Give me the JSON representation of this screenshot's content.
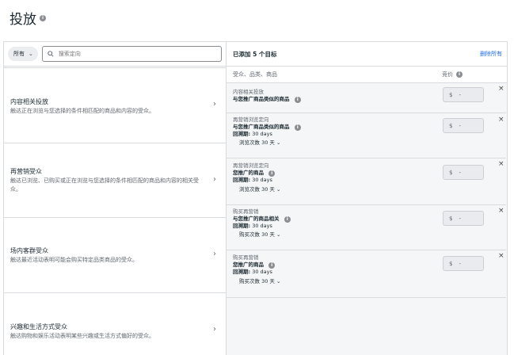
{
  "page": {
    "title": "投放"
  },
  "filter": {
    "dropdown_label": "所有",
    "search_placeholder": "搜索定向"
  },
  "categories": [
    {
      "title": "内容相关投放",
      "desc": "触达正在浏览与您选择的条件相匹配的商品和内容的受众。"
    },
    {
      "title": "再营销受众",
      "desc": "触达已浏览、已购买或正在浏览与您选择的条件相匹配的商品和内容的相关受众。"
    },
    {
      "title": "场内客群受众",
      "desc": "触达最近活动表明可能会购买特定品类商品的受众。"
    },
    {
      "title": "兴趣和生活方式受众",
      "desc": "触达购物和娱乐活动表明某些兴趣或生活方式偏好的受众。"
    }
  ],
  "right": {
    "count_label": "已添加 5 个目标",
    "clear_all": "删除所有",
    "col_target": "受众、品类、商品",
    "col_bid": "竞价",
    "lookback_label": "回溯期:",
    "bid_symbol": "$",
    "bid_value": "-",
    "close_glyph": "×",
    "targets": [
      {
        "type": "内容相关投放",
        "name": "与您推广商品类似的商品"
      },
      {
        "type": "再营销浏览定向",
        "name": "与您推广商品类似的商品",
        "lookback": "30 days",
        "freq": "浏览次数 30 天"
      },
      {
        "type": "再营销浏览定向",
        "name": "您推广的商品",
        "lookback": "30 days",
        "freq": "浏览次数 30 天"
      },
      {
        "type": "购买再营销",
        "name": "与您推广的商品相关",
        "lookback": "30 days",
        "freq": "购买次数 30 天"
      },
      {
        "type": "购买再营销",
        "name": "您推广的商品",
        "lookback": "30 days",
        "freq": "购买次数 30 天"
      }
    ]
  },
  "colors": {
    "link": "#216fdb",
    "border": "#d8dbdf",
    "panel": "#f5f6f7"
  }
}
